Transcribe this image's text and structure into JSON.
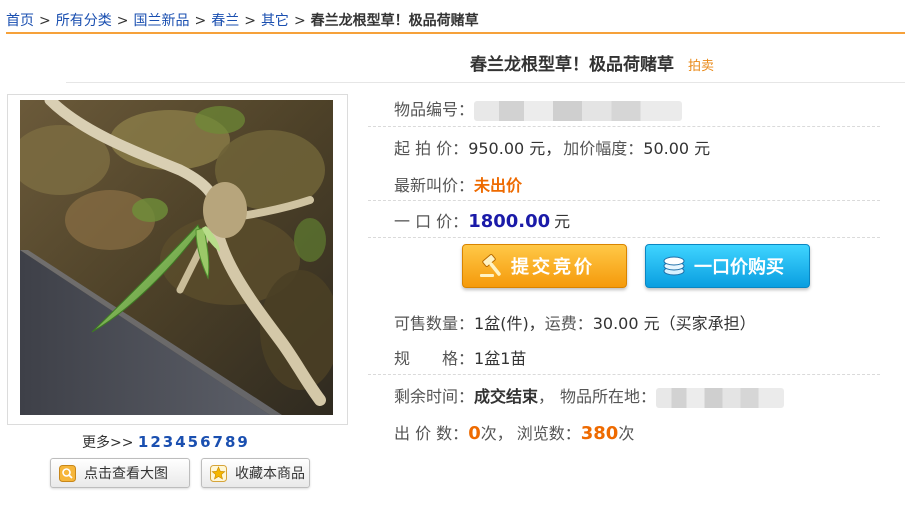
{
  "breadcrumb": {
    "items": [
      "首页",
      "所有分类",
      "国兰新品",
      "春兰",
      "其它"
    ],
    "separator": ">",
    "current": "春兰龙根型草！极品荷赌草"
  },
  "product": {
    "title": "春兰龙根型草！极品荷赌草",
    "tag": "拍卖"
  },
  "gallery": {
    "more_label": "更多>>",
    "pages": [
      "1",
      "2",
      "3",
      "4",
      "5",
      "6",
      "7",
      "8",
      "9"
    ],
    "view_large_label": "点击查看大图",
    "favorite_label": "收藏本商品"
  },
  "details": {
    "item_no_label": "物品编号：",
    "start_price_label": "起 拍 价：",
    "start_price_value": "950.00 元，",
    "increment_label": "加价幅度：",
    "increment_value": "50.00 元",
    "latest_bid_label": "最新叫价：",
    "latest_bid_value": "未出价",
    "buyout_label": "一 口 价：",
    "buyout_value": "1800.00",
    "buyout_unit": "元",
    "quantity_label": "可售数量：",
    "quantity_value": "1盆(件)，",
    "shipping_label": "运费：",
    "shipping_value": "30.00 元（买家承担）",
    "spec_label": "规　　格：",
    "spec_value": "1盆1苗",
    "remaining_label": "剩余时间：",
    "remaining_value": "成交结束",
    "remaining_sep": "，",
    "location_label": "物品所在地：",
    "bids_label": "出 价 数：",
    "bids_value": "0",
    "bids_unit": "次，",
    "views_label": "浏览数：",
    "views_value": "380",
    "views_unit": "次"
  },
  "actions": {
    "bid_label": "提交竞价",
    "buy_label": "一口价购买"
  },
  "colors": {
    "accent_orange": "#f6a13a",
    "link_blue": "#1a4fb0",
    "price_blue": "#1a1aa8",
    "highlight_orange": "#ee6a00"
  }
}
